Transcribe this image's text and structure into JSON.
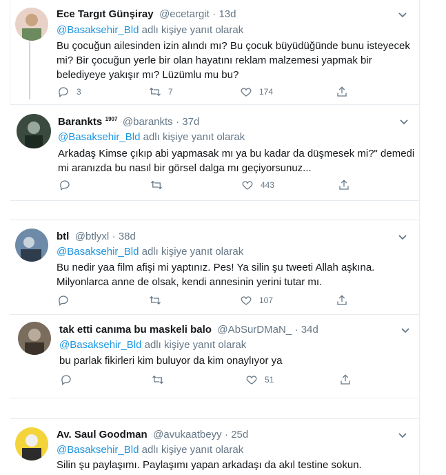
{
  "reply_label": "adlı kişiye yanıt olarak",
  "tweets": [
    {
      "name": "Ece Targıt Günşiray",
      "handle": "@ecetargit",
      "time": "13d",
      "mention": "@Basaksehir_Bld",
      "lines": [
        "Bu çocuğun ailesinden izin alındı mı? Bu çocuk büyüdüğünde bunu isteyecek",
        "mi? Bir çocuğun yerle bir olan hayatını reklam malzemesi yapmak bir",
        "belediyeye yakışır mı? Lüzümlu mu bu?"
      ],
      "replies": "3",
      "retweets": "7",
      "likes": "174",
      "avatar_colors": [
        "#e8d2c8",
        "#c9a37f",
        "#6b8a5d"
      ]
    },
    {
      "name": "Barankts",
      "badge": "1907",
      "handle": "@barankts",
      "time": "37d",
      "mention": "@Basaksehir_Bld",
      "lines": [
        "Arkadaş Kimse çıkıp abi yapmasak mı ya bu kadar da düşmesek mi?\" demedi",
        "mi aranızda bu nasıl bir görsel dalga mı geçiyorsunuz..."
      ],
      "replies": "",
      "retweets": "",
      "likes": "443",
      "avatar_colors": [
        "#3a4a3f",
        "#1d2a22",
        "#9aa89b"
      ]
    },
    {
      "name": "btl",
      "handle": "@btlyxl",
      "time": "38d",
      "mention": "@Basaksehir_Bld",
      "lines": [
        "Bu nedir yaa film afişi mi yaptınız. Pes! Ya silin şu tweeti Allah aşkına.",
        "Milyonlarca anne de olsak, kendi annesinin yerini tutar mı."
      ],
      "replies": "",
      "retweets": "",
      "likes": "107",
      "avatar_colors": [
        "#6d8aa8",
        "#2f3c4b",
        "#c9d3dc"
      ]
    },
    {
      "name": "tak etti canıma bu maskeli balo",
      "handle": "@AbSurDMaN_",
      "time": "34d",
      "mention": "@Basaksehir_Bld",
      "lines": [
        "bu parlak fikirleri kim buluyor da kim onaylıyor ya"
      ],
      "replies": "",
      "retweets": "",
      "likes": "51",
      "avatar_colors": [
        "#7a6d5e",
        "#3b332b",
        "#b8ab9b"
      ]
    },
    {
      "name": "Av. Saul Goodman",
      "handle": "@avukaatbeyy",
      "time": "25d",
      "mention": "@Basaksehir_Bld",
      "lines": [
        "Silin şu paylaşımı. Paylaşımı yapan arkadaşı da akıl testine sokun."
      ],
      "avatar_colors": [
        "#f3d43a",
        "#2b2b2b",
        "#f0f0f0"
      ]
    }
  ]
}
